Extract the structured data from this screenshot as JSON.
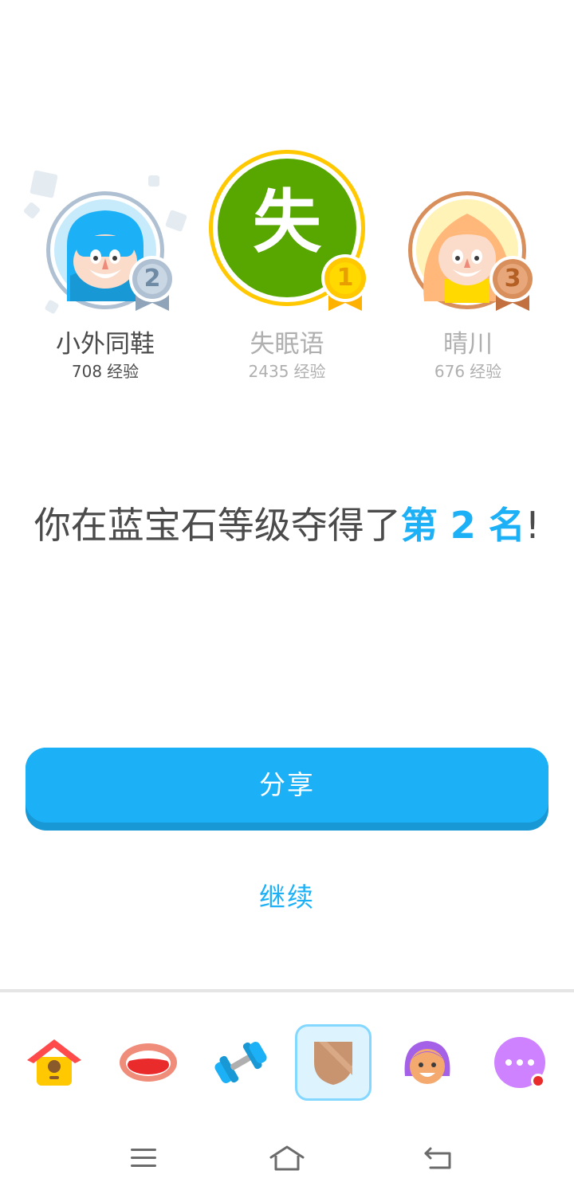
{
  "leaderboard": {
    "players": [
      {
        "rank": "2",
        "name": "小外同鞋",
        "xp": "708",
        "xp_unit": "经验"
      },
      {
        "rank": "1",
        "name": "失眠语",
        "xp": "2435",
        "xp_unit": "经验",
        "avatar_letter": "失"
      },
      {
        "rank": "3",
        "name": "晴川",
        "xp": "676",
        "xp_unit": "经验"
      }
    ]
  },
  "result": {
    "text_before": "你在蓝宝石等级夺得了",
    "highlight": "第 2 名",
    "text_after": "!"
  },
  "actions": {
    "share_label": "分享",
    "continue_label": "继续"
  },
  "tabbar": {
    "items": [
      {
        "icon": "home-icon"
      },
      {
        "icon": "speaking-icon"
      },
      {
        "icon": "practice-dumbbell-icon"
      },
      {
        "icon": "league-shield-icon",
        "active": true
      },
      {
        "icon": "profile-icon"
      },
      {
        "icon": "more-icon",
        "notification": true
      }
    ]
  },
  "colors": {
    "accent": "#1cb0f6",
    "gold": "#ffc800",
    "silver": "#afc0d2",
    "bronze": "#d98f5c",
    "avatar_green": "#58a700"
  }
}
